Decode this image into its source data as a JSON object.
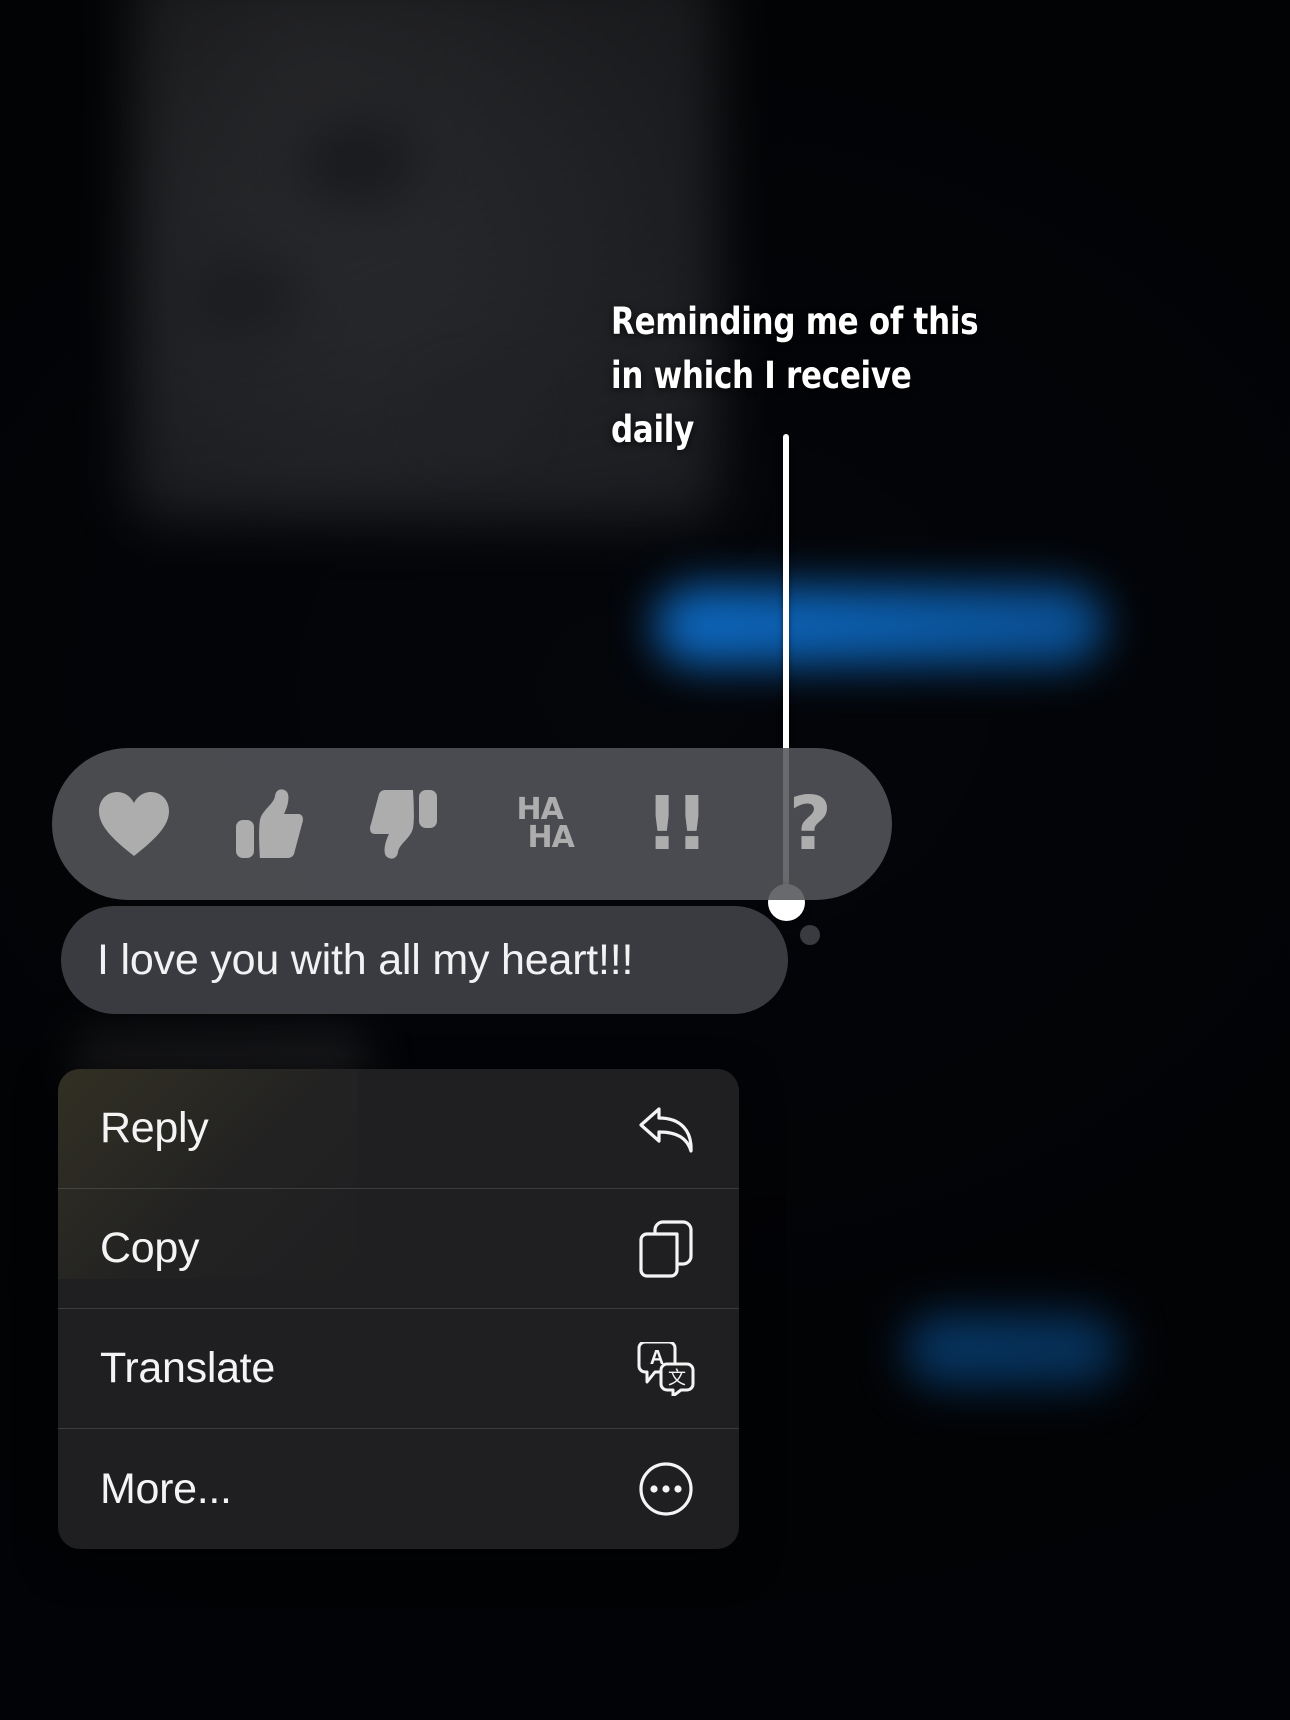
{
  "annotation": {
    "line1": "Reminding me of this",
    "line2": "in which I receive daily",
    "color": "#ffffff"
  },
  "reaction_bar": {
    "background_color": "#54555a",
    "icon_color": "#adadad",
    "reactions": [
      {
        "name": "heart-reaction",
        "label": "Heart",
        "glyph": "heart"
      },
      {
        "name": "thumbsup-reaction",
        "label": "Thumbs Up",
        "glyph": "thumbs-up"
      },
      {
        "name": "thumbsdown-reaction",
        "label": "Thumbs Down",
        "glyph": "thumbs-down"
      },
      {
        "name": "haha-reaction",
        "label": "HA HA",
        "glyph": "haha",
        "line1": "HA",
        "line2": "HA"
      },
      {
        "name": "exclamation-reaction",
        "label": "Exclamation",
        "glyph": "!!"
      },
      {
        "name": "question-reaction",
        "label": "Question",
        "glyph": "?"
      }
    ]
  },
  "message": {
    "text": "I love you with all my heart!!!",
    "bubble_color": "#3a3b40",
    "text_color": "#f2f2f4"
  },
  "context_menu": {
    "background_color": "#1f1f21",
    "items": [
      {
        "label": "Reply",
        "icon": "reply-arrow-icon"
      },
      {
        "label": "Copy",
        "icon": "copy-pages-icon"
      },
      {
        "label": "Translate",
        "icon": "translate-bubbles-icon"
      },
      {
        "label": "More...",
        "icon": "ellipsis-circle-icon"
      }
    ]
  },
  "background": {
    "accent_blue": "#1186f7",
    "page_color": "#05070c"
  }
}
